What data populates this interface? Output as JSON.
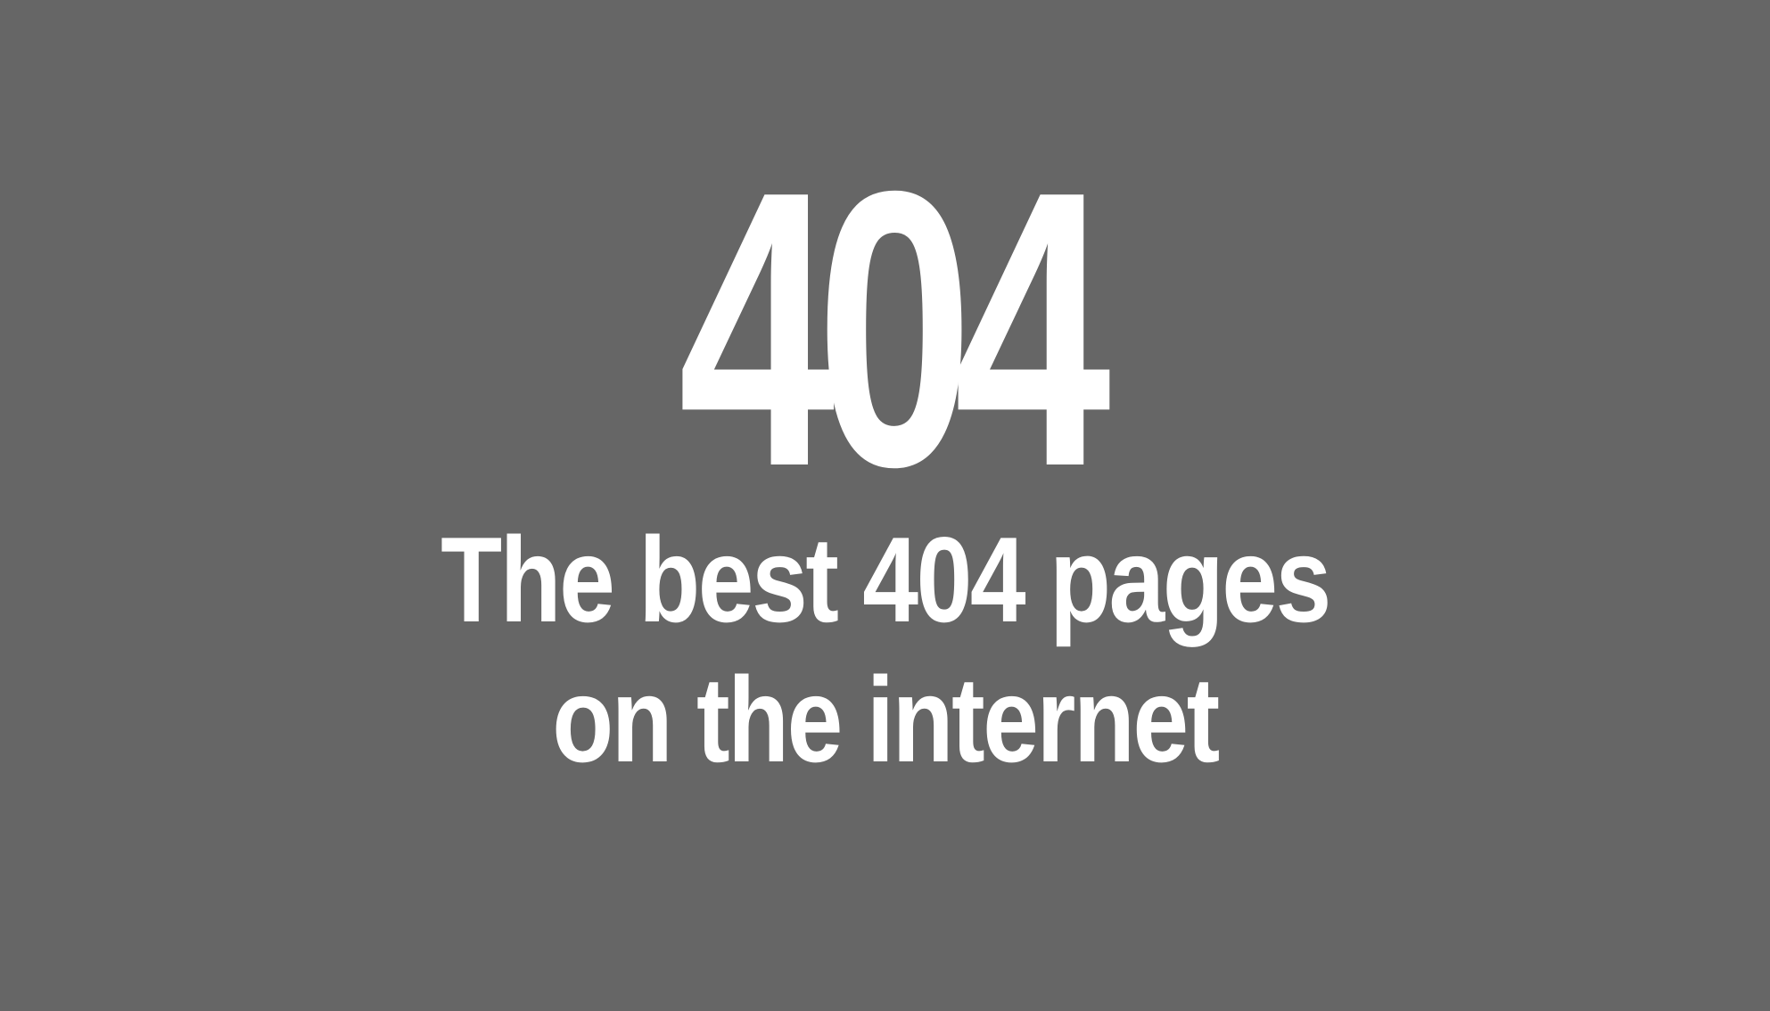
{
  "graphic": {
    "background_color": "#666666",
    "text_color": "#ffffff",
    "code": "404",
    "tagline_line_1": "The best 404 pages",
    "tagline_line_2": "on the internet"
  }
}
